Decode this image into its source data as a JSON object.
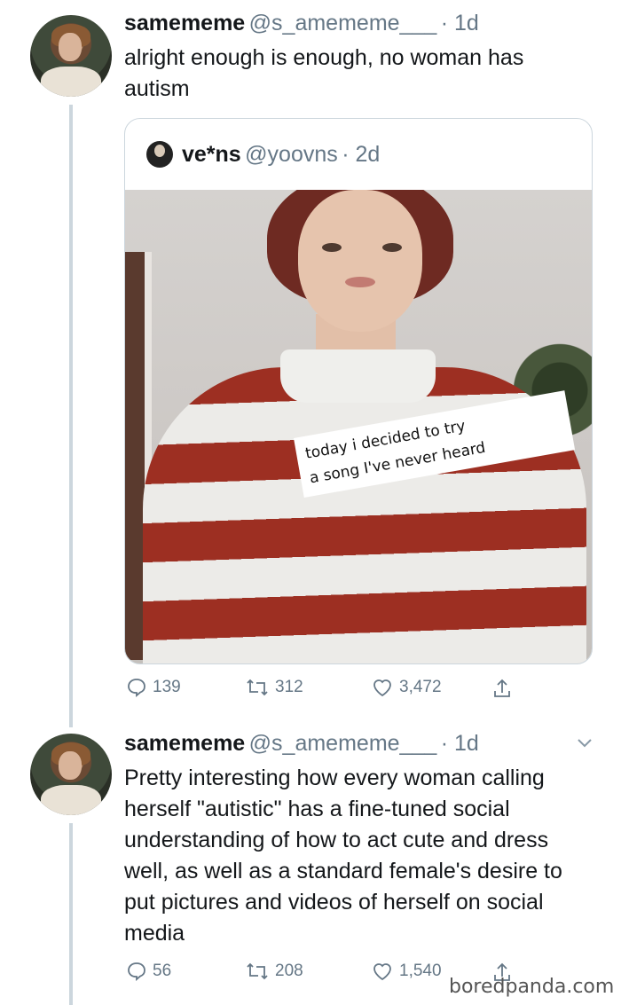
{
  "tweet1": {
    "name": "samememe",
    "handle": "@s_amememe___",
    "time": "· 1d",
    "text": "alright enough is enough, no woman has autism",
    "quote": {
      "name": "ve*ns",
      "handle": "@yoovns",
      "time": "· 2d",
      "caption_line1": "today i decided to try",
      "caption_line2": "a song I've never heard"
    },
    "replies": "139",
    "retweets": "312",
    "likes": "3,472"
  },
  "tweet2": {
    "name": "samememe",
    "handle": "@s_amememe___",
    "time": "· 1d",
    "text": "Pretty interesting how every woman calling herself \"autistic\" has a fine-tuned social understanding of how to act cute and dress well, as well as a standard female's desire to put pictures and videos of herself on social media",
    "replies": "56",
    "retweets": "208",
    "likes": "1,540"
  },
  "watermark": "boredpanda.com",
  "icons": [
    "reply-icon",
    "retweet-icon",
    "like-icon",
    "share-icon",
    "chevron-down-icon"
  ]
}
